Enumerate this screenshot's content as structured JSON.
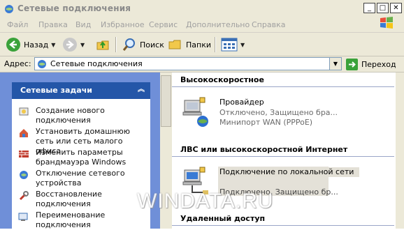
{
  "window": {
    "title": "Сетевые подключения"
  },
  "menu": {
    "items": [
      "Файл",
      "Правка",
      "Вид",
      "Избранное",
      "Сервис",
      "Дополнительно",
      "Справка"
    ]
  },
  "toolbar": {
    "back_label": "Назад",
    "search_label": "Поиск",
    "folders_label": "Папки"
  },
  "address": {
    "label": "Адрес:",
    "value": "Сетевые подключения",
    "go_label": "Переход"
  },
  "tasks": {
    "header": "Сетевые задачи",
    "items": [
      {
        "label": "Создание нового подключения",
        "icon": "new-connection-icon"
      },
      {
        "label": "Установить домашнюю сеть или сеть малого офиса",
        "icon": "home-network-icon"
      },
      {
        "label": "Изменить параметры брандмауэра Windows",
        "icon": "firewall-icon"
      },
      {
        "label": "Отключение сетевого устройства",
        "icon": "disable-device-icon"
      },
      {
        "label": "Восстановление подключения",
        "icon": "repair-icon"
      },
      {
        "label": "Переименование подключения",
        "icon": "rename-icon"
      }
    ]
  },
  "groups": [
    {
      "title": "Высокоскоростное",
      "items": [
        {
          "name": "Провайдер",
          "status": "Отключено, Защищено бра...",
          "device": "Минипорт WAN (PPPoE)"
        }
      ]
    },
    {
      "title": "ЛВС или высокоскоростной Интернет",
      "items": [
        {
          "name": "Подключение по локальной сети",
          "status": "Подключено, Защищено бр..."
        }
      ]
    },
    {
      "title": "Удаленный доступ",
      "items": []
    }
  ],
  "watermark": "WINDATA.RU",
  "colors": {
    "task_pane_bg": "#6f8fd8",
    "task_header_bg": "#2456a8",
    "chrome_bg": "#ece9d8"
  }
}
